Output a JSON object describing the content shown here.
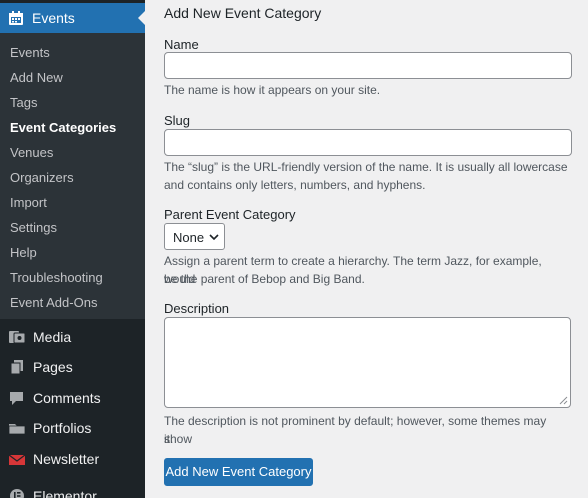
{
  "sidebar": {
    "active": {
      "label": "Events",
      "icon": "calendar-icon"
    },
    "submenu": [
      {
        "label": "Events"
      },
      {
        "label": "Add New"
      },
      {
        "label": "Tags"
      },
      {
        "label": "Event Categories",
        "current": true
      },
      {
        "label": "Venues"
      },
      {
        "label": "Organizers"
      },
      {
        "label": "Import"
      },
      {
        "label": "Settings"
      },
      {
        "label": "Help"
      },
      {
        "label": "Troubleshooting"
      },
      {
        "label": "Event Add-Ons"
      }
    ],
    "menu": [
      {
        "label": "Media",
        "icon": "media-icon"
      },
      {
        "label": "Pages",
        "icon": "pages-icon"
      },
      {
        "label": "Comments",
        "icon": "comments-icon"
      },
      {
        "label": "Portfolios",
        "icon": "portfolio-icon"
      },
      {
        "label": "Newsletter",
        "icon": "newsletter-icon"
      },
      {
        "label": "Elementor",
        "icon": "elementor-icon"
      }
    ]
  },
  "form": {
    "title": "Add New Event Category",
    "name_label": "Name",
    "name_value": "",
    "name_help": "The name is how it appears on your site.",
    "slug_label": "Slug",
    "slug_value": "",
    "slug_help_1": "The “slug” is the URL-friendly version of the name. It is usually all lowercase",
    "slug_help_2": "and contains only letters, numbers, and hyphens.",
    "parent_label": "Parent Event Category",
    "parent_value": "None",
    "parent_help_1": "Assign a parent term to create a hierarchy. The term Jazz, for example, would",
    "parent_help_2": "be the parent of Bebop and Big Band.",
    "description_label": "Description",
    "description_value": "",
    "description_help_1": "The description is not prominent by default; however, some themes may show",
    "description_help_2": "it.",
    "submit_label": "Add New Event Category"
  },
  "colors": {
    "sidebar_bg": "#1d2327",
    "submenu_bg": "#2c3338",
    "accent": "#2271b1",
    "page_bg": "#f0f0f1",
    "newsletter_icon": "#d63638"
  }
}
